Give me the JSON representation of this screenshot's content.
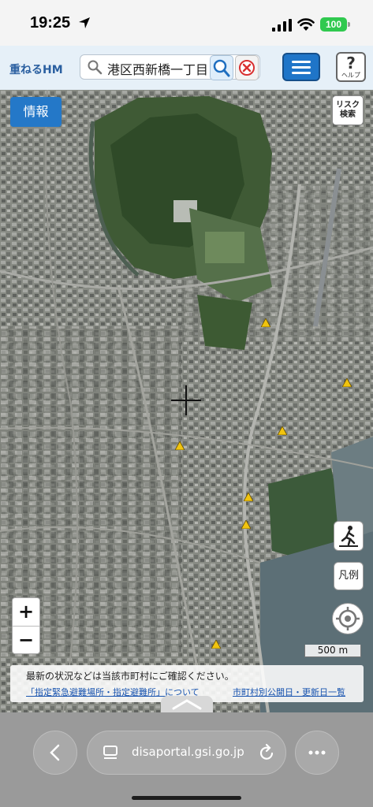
{
  "status_bar": {
    "time": "19:25",
    "battery": "100"
  },
  "header": {
    "app_title": "重ねるHM",
    "search_value": "港区西新橋一丁目",
    "help_label": "ヘルプ"
  },
  "map": {
    "info_button": "情報",
    "risk_button_line1": "リスク",
    "risk_button_line2": "検索",
    "legend_button": "凡例",
    "zoom_in": "+",
    "zoom_out": "−",
    "scale": "500 m",
    "notice": {
      "line1": "最新の状況などは当該市町村にご確認ください。",
      "link1": "「指定緊急避難場所・指定避難所」について",
      "link2": "市町村別公開日・更新日一覧"
    }
  },
  "browser": {
    "url": "disaportal.gsi.go.jp"
  },
  "colors": {
    "accent": "#1f75c8",
    "battery": "#30c94f",
    "link": "#1a55b0"
  }
}
